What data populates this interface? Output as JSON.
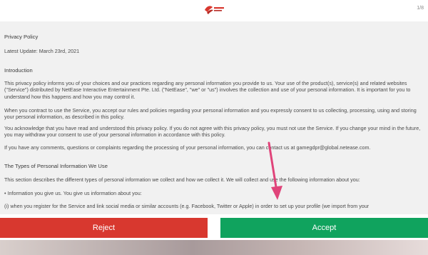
{
  "page_indicator": "1/8",
  "logo_alt": "NetEase Games",
  "policy": {
    "title": "Privacy Policy",
    "latest_update": "Latest Update:  March 23rd, 2021",
    "intro_heading": "Introduction",
    "intro_p1": "This privacy policy informs you of your choices and our practices regarding any personal information you provide to us. Your use of the product(s), service(s) and related websites (\"Service\") distributed by NetEase Interactive Entertainment Pte. Ltd. (\"NetEase\", \"we\" or \"us\") involves the collection and use of your personal information. It is important for you to understand how this happens and how you may control it.",
    "intro_p2": "When you contract to use the Service, you accept our rules and policies regarding your personal information and you expressly consent to us collecting, processing, using and storing your personal information, as described in this policy.",
    "intro_p3": "You acknowledge that you have read and understood this privacy policy. If you do not agree with this privacy policy, you must not use the Service. If you change your mind in the future, you may withdraw your consent to use of your personal information in accordance with this policy.",
    "intro_p4": "If you have any comments, questions or complaints regarding the processing of your personal information, you can contact us at gamegdpr@global.netease.com.",
    "types_heading": "The Types of Personal Information We Use",
    "types_p1": "This section describes the different types of personal information we collect and how we collect it. We will collect and use the following information about you:",
    "types_bullet": "•  Information you give us. You give us information about you:",
    "types_item": "(i) when you register for the Service and link social media or similar accounts (e.g. Facebook, Twitter or Apple) in order to set up your profile (we import from your"
  },
  "buttons": {
    "reject": "Reject",
    "accept": "Accept"
  },
  "colors": {
    "reject": "#d8382f",
    "accept": "#10a35e",
    "annotation_arrow": "#e0447a"
  }
}
